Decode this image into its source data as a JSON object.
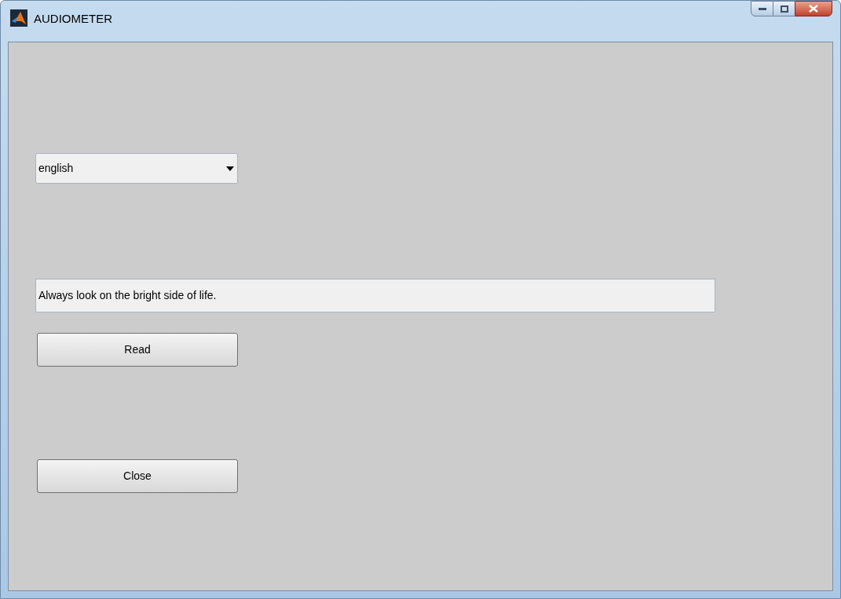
{
  "window": {
    "title": "AUDIOMETER"
  },
  "language_dropdown": {
    "value": "english"
  },
  "text_field": {
    "value": "Always look on the bright side of life."
  },
  "buttons": [
    {
      "label": "Read"
    },
    {
      "label": "Close"
    }
  ]
}
